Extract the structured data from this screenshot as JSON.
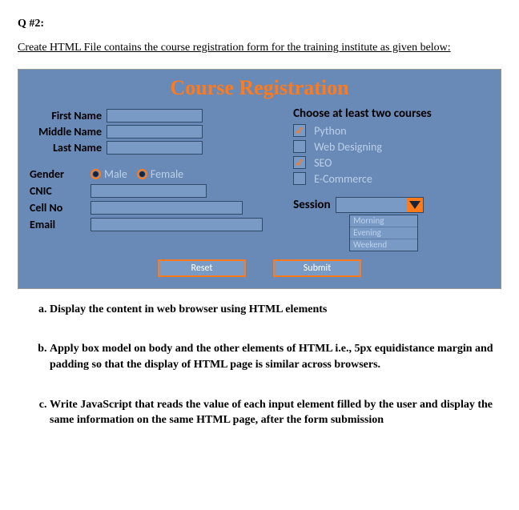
{
  "heading": "Q #2:",
  "prompt": "Create HTML File contains  the course registration form for the training institute as given below:",
  "form": {
    "title": "Course Registration",
    "names": {
      "first_label": "First Name",
      "middle_label": "Middle Name",
      "last_label": "Last Name"
    },
    "gender": {
      "label": "Gender",
      "options": {
        "male": "Male",
        "female": "Female"
      },
      "selected": "Male"
    },
    "fields": {
      "cnic_label": "CNIC",
      "cell_label": "Cell No",
      "email_label": "Email"
    },
    "courses": {
      "heading": "Choose at least two courses",
      "items": [
        {
          "label": "Python",
          "checked": true
        },
        {
          "label": "Web Designing",
          "checked": false
        },
        {
          "label": "SEO",
          "checked": true
        },
        {
          "label": "E-Commerce",
          "checked": false
        }
      ]
    },
    "session": {
      "label": "Session",
      "options": [
        "Morning",
        "Evening",
        "Weekend"
      ]
    },
    "buttons": {
      "reset": "Reset",
      "submit": "Submit"
    }
  },
  "sub_questions": {
    "a": "Display the content in web browser using HTML elements",
    "b": "Apply box model on body and the other elements of HTML i.e., 5px equidistance margin and padding so that the display of HTML page is similar across browsers.",
    "c": "Write JavaScript that reads the value of each input element filled by the user and display the same information on the same HTML page, after the form submission"
  }
}
